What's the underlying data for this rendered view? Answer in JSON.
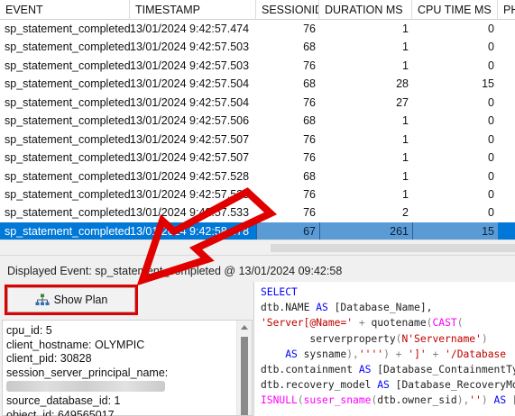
{
  "grid": {
    "columns": [
      "EVENT",
      "TIMESTAMP",
      "SESSIONID",
      "DURATION MS",
      "CPU TIME MS",
      "PH"
    ],
    "rows": [
      {
        "event": "sp_statement_completed",
        "timestamp": "13/01/2024 9:42:57.474",
        "sessionid": "76",
        "duration": "1",
        "cpu": "0"
      },
      {
        "event": "sp_statement_completed",
        "timestamp": "13/01/2024 9:42:57.503",
        "sessionid": "68",
        "duration": "1",
        "cpu": "0"
      },
      {
        "event": "sp_statement_completed",
        "timestamp": "13/01/2024 9:42:57.503",
        "sessionid": "76",
        "duration": "1",
        "cpu": "0"
      },
      {
        "event": "sp_statement_completed",
        "timestamp": "13/01/2024 9:42:57.504",
        "sessionid": "68",
        "duration": "28",
        "cpu": "15"
      },
      {
        "event": "sp_statement_completed",
        "timestamp": "13/01/2024 9:42:57.504",
        "sessionid": "76",
        "duration": "27",
        "cpu": "0"
      },
      {
        "event": "sp_statement_completed",
        "timestamp": "13/01/2024 9:42:57.506",
        "sessionid": "68",
        "duration": "1",
        "cpu": "0"
      },
      {
        "event": "sp_statement_completed",
        "timestamp": "13/01/2024 9:42:57.507",
        "sessionid": "76",
        "duration": "1",
        "cpu": "0"
      },
      {
        "event": "sp_statement_completed",
        "timestamp": "13/01/2024 9:42:57.507",
        "sessionid": "76",
        "duration": "1",
        "cpu": "0"
      },
      {
        "event": "sp_statement_completed",
        "timestamp": "13/01/2024 9:42:57.528",
        "sessionid": "68",
        "duration": "1",
        "cpu": "0"
      },
      {
        "event": "sp_statement_completed",
        "timestamp": "13/01/2024 9:42:57.533",
        "sessionid": "76",
        "duration": "1",
        "cpu": "0"
      },
      {
        "event": "sp_statement_completed",
        "timestamp": "13/01/2024 9:42:57.533",
        "sessionid": "76",
        "duration": "2",
        "cpu": "0"
      },
      {
        "event": "sp_statement_completed",
        "timestamp": "13/01/2024 9:42:58.478",
        "sessionid": "67",
        "duration": "261",
        "cpu": "15",
        "selected": true
      }
    ]
  },
  "status": {
    "displayed_event": "Displayed Event:  sp_statement_completed @ 13/01/2024 09:42:58"
  },
  "show_plan": {
    "label": "Show Plan",
    "icon": "plan-tree-icon"
  },
  "properties": [
    {
      "text": "cpu_id: 5"
    },
    {
      "text": "client_hostname: OLYMPIC"
    },
    {
      "text": "client_pid: 30828"
    },
    {
      "text": "session_server_principal_name:"
    },
    {
      "text": "",
      "redacted": true
    },
    {
      "text": "source_database_id: 1"
    },
    {
      "text": "object_id: 649565017"
    }
  ],
  "sql": {
    "lines": [
      [
        {
          "t": "SELECT",
          "k": "kw"
        }
      ],
      [
        {
          "t": "dtb.NAME ",
          "k": ""
        },
        {
          "t": "AS",
          "k": "kw"
        },
        {
          "t": " [Database_Name],",
          "k": ""
        }
      ],
      [
        {
          "t": "'Server[@Name='",
          "k": "st"
        },
        {
          "t": " + ",
          "k": "gr"
        },
        {
          "t": "quotename",
          "k": ""
        },
        {
          "t": "(",
          "k": "gr"
        },
        {
          "t": "CAST",
          "k": "fn"
        },
        {
          "t": "(",
          "k": "gr"
        }
      ],
      [
        {
          "t": "        serverproperty",
          "k": ""
        },
        {
          "t": "(",
          "k": "gr"
        },
        {
          "t": "N'Servername'",
          "k": "st"
        },
        {
          "t": ")",
          "k": "gr"
        }
      ],
      [
        {
          "t": "    AS",
          "k": "kw"
        },
        {
          "t": " sysname",
          "k": ""
        },
        {
          "t": "),",
          "k": "gr"
        },
        {
          "t": "''''",
          "k": "st"
        },
        {
          "t": ") + ",
          "k": "gr"
        },
        {
          "t": "']'",
          "k": "st"
        },
        {
          "t": " + ",
          "k": "gr"
        },
        {
          "t": "'/Database",
          "k": "st"
        }
      ],
      [
        {
          "t": "dtb.containment ",
          "k": ""
        },
        {
          "t": "AS",
          "k": "kw"
        },
        {
          "t": " [Database_ContainmentTyp",
          "k": ""
        }
      ],
      [
        {
          "t": "dtb.recovery_model ",
          "k": ""
        },
        {
          "t": "AS",
          "k": "kw"
        },
        {
          "t": " [Database_RecoveryMod",
          "k": ""
        }
      ],
      [
        {
          "t": "ISNULL",
          "k": "fn"
        },
        {
          "t": "(",
          "k": "gr"
        },
        {
          "t": "suser_sname",
          "k": "fn"
        },
        {
          "t": "(",
          "k": "gr"
        },
        {
          "t": "dtb.owner_sid",
          "k": ""
        },
        {
          "t": "),",
          "k": "gr"
        },
        {
          "t": "''",
          "k": "st"
        },
        {
          "t": ") ",
          "k": "gr"
        },
        {
          "t": "AS",
          "k": "kw"
        },
        {
          "t": " [D",
          "k": ""
        }
      ]
    ]
  },
  "colors": {
    "selection": "#0078d7",
    "annotation_red": "#e00000",
    "keyword_blue": "#0000ff",
    "function_magenta": "#ff00ff",
    "string_red": "#c00000"
  }
}
